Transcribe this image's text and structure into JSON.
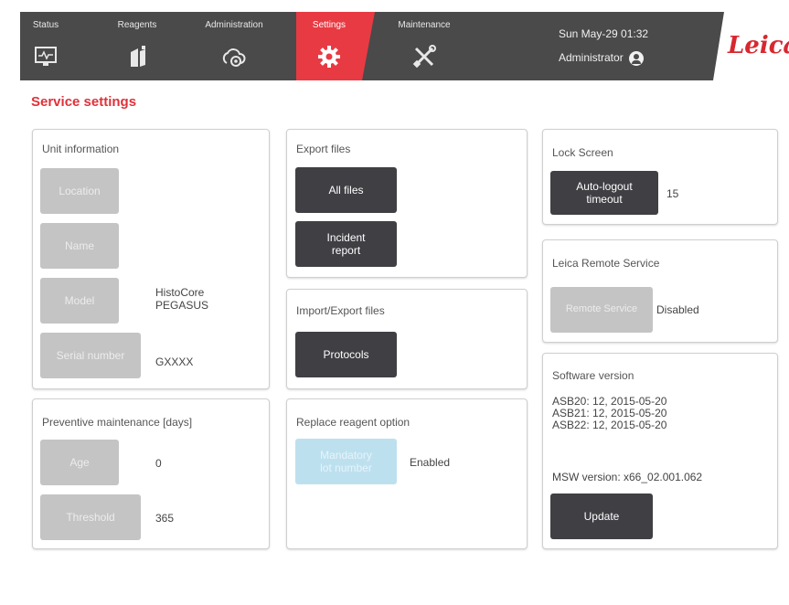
{
  "header": {
    "tabs": [
      {
        "label": "Status",
        "icon": "monitor-icon"
      },
      {
        "label": "Reagents",
        "icon": "bottle-icon"
      },
      {
        "label": "Administration",
        "icon": "cloud-gear-icon"
      },
      {
        "label": "Settings",
        "icon": "gear-icon"
      },
      {
        "label": "Maintenance",
        "icon": "tools-icon"
      }
    ],
    "active_tab": "Settings",
    "datetime": "Sun May-29 01:32",
    "user": "Administrator",
    "logo": "Leica"
  },
  "page_title": "Service settings",
  "unit_info": {
    "title": "Unit information",
    "location_label": "Location",
    "name_label": "Name",
    "model_label": "Model",
    "model_value_1": "HistoCore",
    "model_value_2": "PEGASUS",
    "serial_label": "Serial number",
    "serial_value": "GXXXX"
  },
  "preventive": {
    "title": "Preventive maintenance [days]",
    "age_label": "Age",
    "age_value": "0",
    "threshold_label": "Threshold",
    "threshold_value": "365"
  },
  "export_files": {
    "title": "Export files",
    "all_files": "All files",
    "incident_1": "Incident",
    "incident_2": "report"
  },
  "import_export": {
    "title": "Import/Export files",
    "protocols": "Protocols"
  },
  "replace_reagent": {
    "title": "Replace reagent option",
    "button_1": "Mandatory",
    "button_2": "lot number",
    "status": "Enabled"
  },
  "lock_screen": {
    "title": "Lock Screen",
    "button_1": "Auto-logout",
    "button_2": "timeout",
    "value": "15"
  },
  "remote_service": {
    "title": "Leica Remote Service",
    "button": "Remote Service",
    "status": "Disabled"
  },
  "software": {
    "title": "Software version",
    "lines": [
      "ASB20: 12, 2015-05-20",
      "ASB21: 12, 2015-05-20",
      "ASB22: 12, 2015-05-20"
    ],
    "msw": "MSW version: x66_02.001.062",
    "update": "Update"
  },
  "colors": {
    "accent": "#e83a43",
    "header_bg": "#4a4a4a",
    "button_dark": "#3f3f44",
    "button_disabled": "#c4c4c4",
    "button_light_blue": "#bde0ef"
  }
}
